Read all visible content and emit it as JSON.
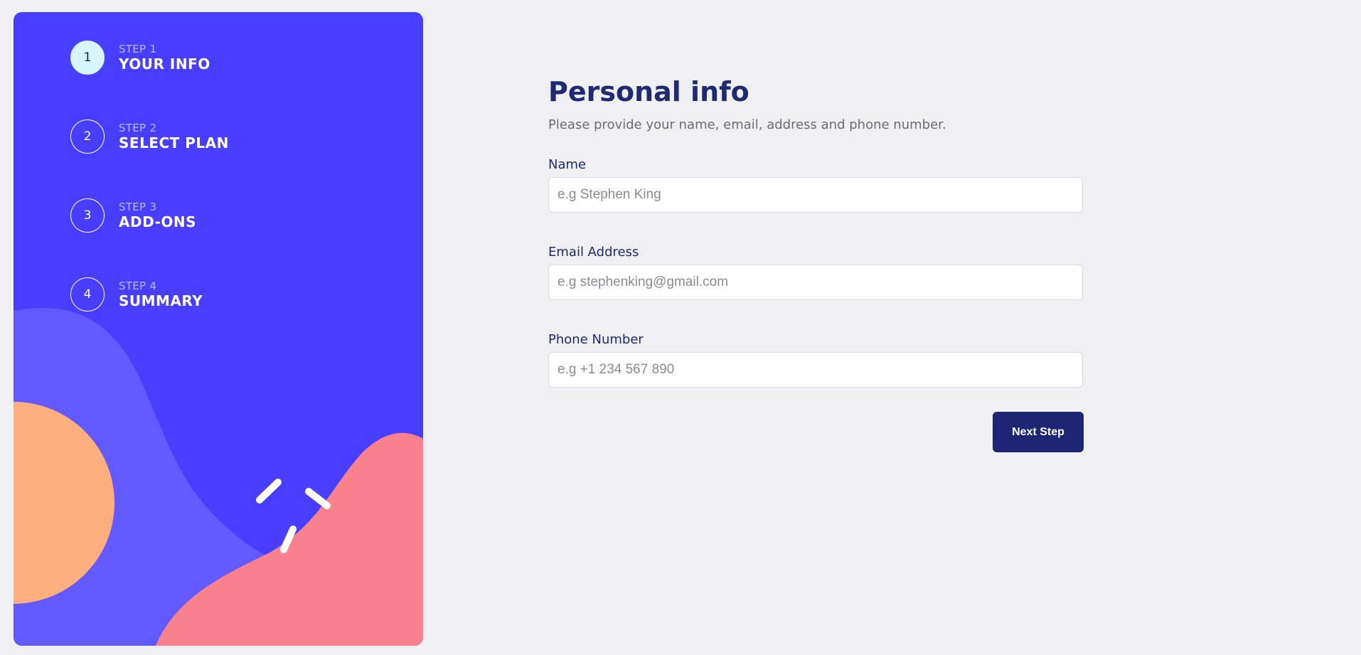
{
  "sidebar": {
    "steps": [
      {
        "label": "STEP 1",
        "title": "YOUR INFO",
        "number": "1",
        "active": true
      },
      {
        "label": "STEP 2",
        "title": "SELECT PLAN",
        "number": "2",
        "active": false
      },
      {
        "label": "STEP 3",
        "title": "ADD-ONS",
        "number": "3",
        "active": false
      },
      {
        "label": "STEP 4",
        "title": "SUMMARY",
        "number": "4",
        "active": false
      }
    ],
    "colors": {
      "background": "#483eff",
      "wave": "#6259ff",
      "orange": "#ffaf7e",
      "pink": "#f9818e"
    }
  },
  "form": {
    "title": "Personal info",
    "subtitle": "Please provide your name, email, address and phone number.",
    "fields": {
      "name": {
        "label": "Name",
        "placeholder": "e.g Stephen King"
      },
      "email": {
        "label": "Email Address",
        "placeholder": "e.g stephenking@gmail.com"
      },
      "phone": {
        "label": "Phone Number",
        "placeholder": "e.g +1 234 567 890"
      }
    },
    "next_label": "Next Step"
  },
  "colors": {
    "page_background": "#f0f0f2",
    "title": "#1f2a72",
    "button": "#1c2674"
  }
}
